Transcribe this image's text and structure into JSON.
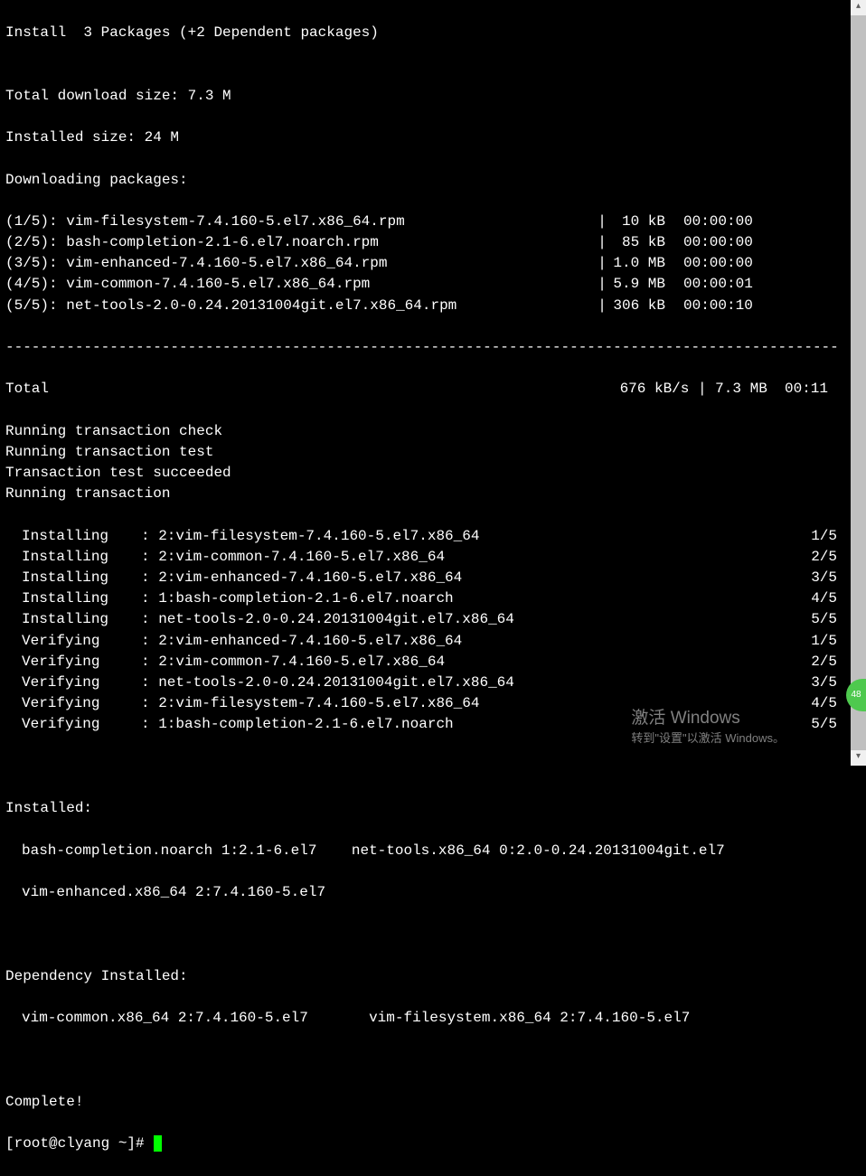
{
  "header": {
    "install_line": "Install  3 Packages (+2 Dependent packages)",
    "blank": "",
    "total_download": "Total download size: 7.3 M",
    "installed_size": "Installed size: 24 M",
    "downloading": "Downloading packages:"
  },
  "downloads": [
    {
      "name": "(1/5): vim-filesystem-7.4.160-5.el7.x86_64.rpm",
      "sep": "|",
      "size": "10 kB",
      "time": "00:00:00"
    },
    {
      "name": "(2/5): bash-completion-2.1-6.el7.noarch.rpm",
      "sep": "|",
      "size": "85 kB",
      "time": "00:00:00"
    },
    {
      "name": "(3/5): vim-enhanced-7.4.160-5.el7.x86_64.rpm",
      "sep": "|",
      "size": "1.0 MB",
      "time": "00:00:00"
    },
    {
      "name": "(4/5): vim-common-7.4.160-5.el7.x86_64.rpm",
      "sep": "|",
      "size": "5.9 MB",
      "time": "00:00:01"
    },
    {
      "name": "(5/5): net-tools-2.0-0.24.20131004git.el7.x86_64.rpm",
      "sep": "|",
      "size": "306 kB",
      "time": "00:00:10"
    }
  ],
  "separator": "--------------------------------------------------------------------------------------------------------",
  "total": {
    "label": "Total",
    "stats": "676 kB/s | 7.3 MB  00:11"
  },
  "tx_lines": [
    "Running transaction check",
    "Running transaction test",
    "Transaction test succeeded",
    "Running transaction"
  ],
  "tx_steps": [
    {
      "action": "Installing ",
      "pkg": ": 2:vim-filesystem-7.4.160-5.el7.x86_64",
      "count": "1/5"
    },
    {
      "action": "Installing ",
      "pkg": ": 2:vim-common-7.4.160-5.el7.x86_64",
      "count": "2/5"
    },
    {
      "action": "Installing ",
      "pkg": ": 2:vim-enhanced-7.4.160-5.el7.x86_64",
      "count": "3/5"
    },
    {
      "action": "Installing ",
      "pkg": ": 1:bash-completion-2.1-6.el7.noarch",
      "count": "4/5"
    },
    {
      "action": "Installing ",
      "pkg": ": net-tools-2.0-0.24.20131004git.el7.x86_64",
      "count": "5/5"
    },
    {
      "action": "Verifying  ",
      "pkg": ": 2:vim-enhanced-7.4.160-5.el7.x86_64",
      "count": "1/5"
    },
    {
      "action": "Verifying  ",
      "pkg": ": 2:vim-common-7.4.160-5.el7.x86_64",
      "count": "2/5"
    },
    {
      "action": "Verifying  ",
      "pkg": ": net-tools-2.0-0.24.20131004git.el7.x86_64",
      "count": "3/5"
    },
    {
      "action": "Verifying  ",
      "pkg": ": 2:vim-filesystem-7.4.160-5.el7.x86_64",
      "count": "4/5"
    },
    {
      "action": "Verifying  ",
      "pkg": ": 1:bash-completion-2.1-6.el7.noarch",
      "count": "5/5"
    }
  ],
  "installed": {
    "header": "Installed:",
    "line1": "bash-completion.noarch 1:2.1-6.el7    net-tools.x86_64 0:2.0-0.24.20131004git.el7",
    "line2": "vim-enhanced.x86_64 2:7.4.160-5.el7"
  },
  "dep_installed": {
    "header": "Dependency Installed:",
    "line1": "vim-common.x86_64 2:7.4.160-5.el7       vim-filesystem.x86_64 2:7.4.160-5.el7"
  },
  "complete": "Complete!",
  "prompt": "[root@clyang ~]# ",
  "watermark": {
    "line1": "激活 Windows",
    "line2": "转到\"设置\"以激活 Windows。"
  },
  "badge": "48"
}
